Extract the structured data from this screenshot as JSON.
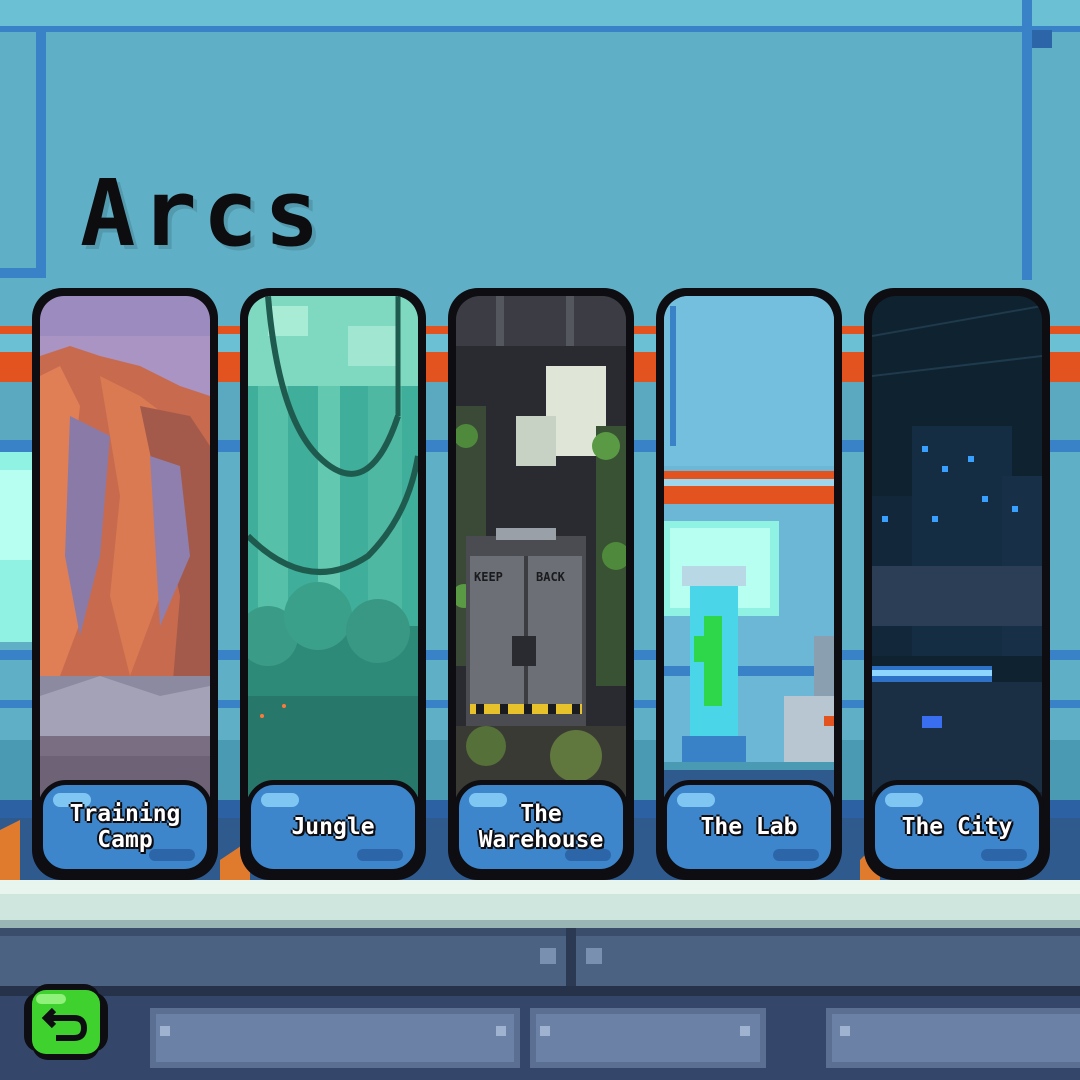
{
  "screen": {
    "title": "Arcs"
  },
  "arcs": [
    {
      "label": "Training\nCamp",
      "scene": "desert-canyon"
    },
    {
      "label": "Jungle",
      "scene": "jungle"
    },
    {
      "label": "The\nWarehouse",
      "scene": "overgrown-warehouse"
    },
    {
      "label": "The Lab",
      "scene": "lab-tube"
    },
    {
      "label": "The City",
      "scene": "night-city"
    }
  ],
  "warehouse_door": {
    "left_text": "KEEP",
    "right_text": "BACK"
  },
  "back": {
    "icon": "back-arrow-icon"
  },
  "colors": {
    "background": "#5fb0c6",
    "stripe_orange": "#e3531f",
    "label_blue": "#3d86cc",
    "back_green": "#3fd12e",
    "outline": "#0d0d12"
  }
}
